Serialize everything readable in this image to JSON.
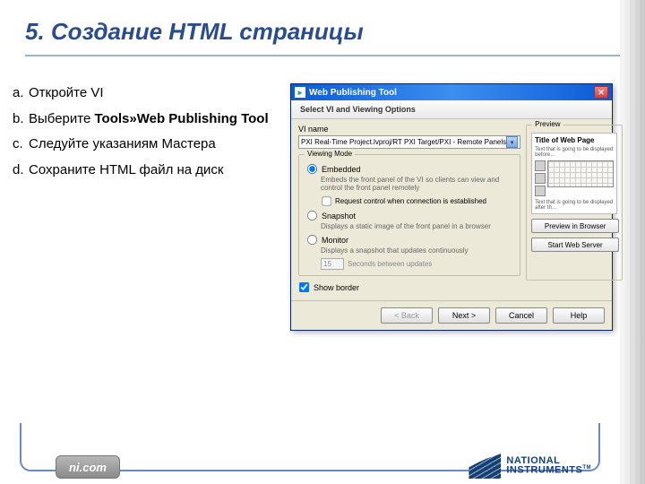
{
  "slide": {
    "title": "5. Создание HTML страницы",
    "steps": [
      {
        "letter": "a.",
        "text": "Откройте VI"
      },
      {
        "letter": "b.",
        "prefix": "Выберите ",
        "bold": "Tools»Web Publishing Tool"
      },
      {
        "letter": "c.",
        "text": "Следуйте указаниям Мастера"
      },
      {
        "letter": "d.",
        "text": "Сохраните HTML файл на диск"
      }
    ],
    "badge": "ni.com",
    "logo1": "NATIONAL",
    "logo2": "INSTRUMENTS",
    "tm": "TM"
  },
  "dialog": {
    "title": "Web Publishing Tool",
    "header": "Select VI and Viewing Options",
    "vi_label": "VI name",
    "vi_value": "PXI Real-Time Project.lvproj/RT PXI Target/PXI - Remote Panels",
    "viewing_mode": "Viewing Mode",
    "embedded": "Embedded",
    "embedded_desc": "Embeds the front panel of the VI so clients can view and control the front panel remotely",
    "request_ctrl": "Request control when connection is established",
    "snapshot": "Snapshot",
    "snapshot_desc": "Displays a static image of the front panel in a browser",
    "monitor": "Monitor",
    "monitor_desc": "Displays a snapshot that updates continuously",
    "seconds_value": "15",
    "seconds_label": "Seconds between updates",
    "show_border": "Show border",
    "preview_label": "Preview",
    "preview_title": "Title of Web Page",
    "preview_before": "Text that is going to be displayed before…",
    "preview_after": "Text that is going to be displayed after th…",
    "btn_preview": "Preview in Browser",
    "btn_start": "Start Web Server",
    "btn_back": "< Back",
    "btn_next": "Next >",
    "btn_cancel": "Cancel",
    "btn_help": "Help"
  }
}
